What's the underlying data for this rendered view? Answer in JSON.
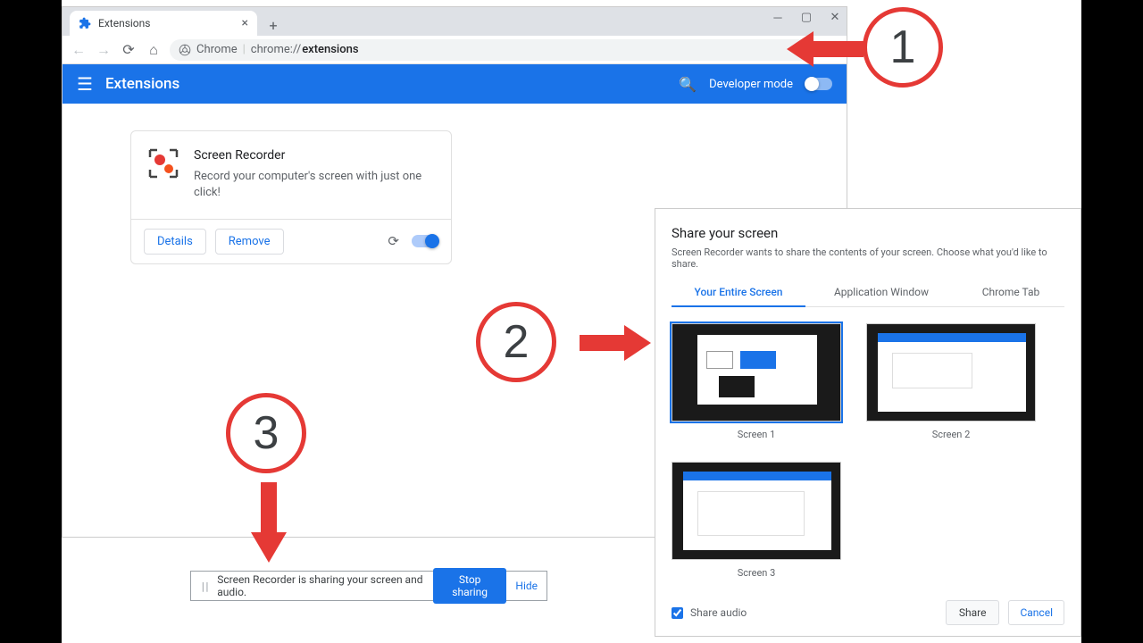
{
  "browser": {
    "tab_title": "Extensions",
    "url_prefix": "Chrome",
    "url_display": "chrome://",
    "url_bold": "extensions"
  },
  "ext_page": {
    "header_title": "Extensions",
    "dev_mode_label": "Developer mode",
    "card": {
      "name": "Screen Recorder",
      "desc": "Record your computer's screen with just one click!",
      "details": "Details",
      "remove": "Remove"
    }
  },
  "share": {
    "title": "Share your screen",
    "subtitle": "Screen Recorder wants to share the contents of your screen. Choose what you'd like to share.",
    "tabs": [
      "Your Entire Screen",
      "Application Window",
      "Chrome Tab"
    ],
    "screens": [
      "Screen 1",
      "Screen 2",
      "Screen 3"
    ],
    "share_audio": "Share audio",
    "share_btn": "Share",
    "cancel_btn": "Cancel"
  },
  "sharing_bar": {
    "text": "Screen Recorder is sharing your screen and audio.",
    "stop": "Stop sharing",
    "hide": "Hide"
  },
  "annotations": {
    "n1": "1",
    "n2": "2",
    "n3": "3"
  }
}
